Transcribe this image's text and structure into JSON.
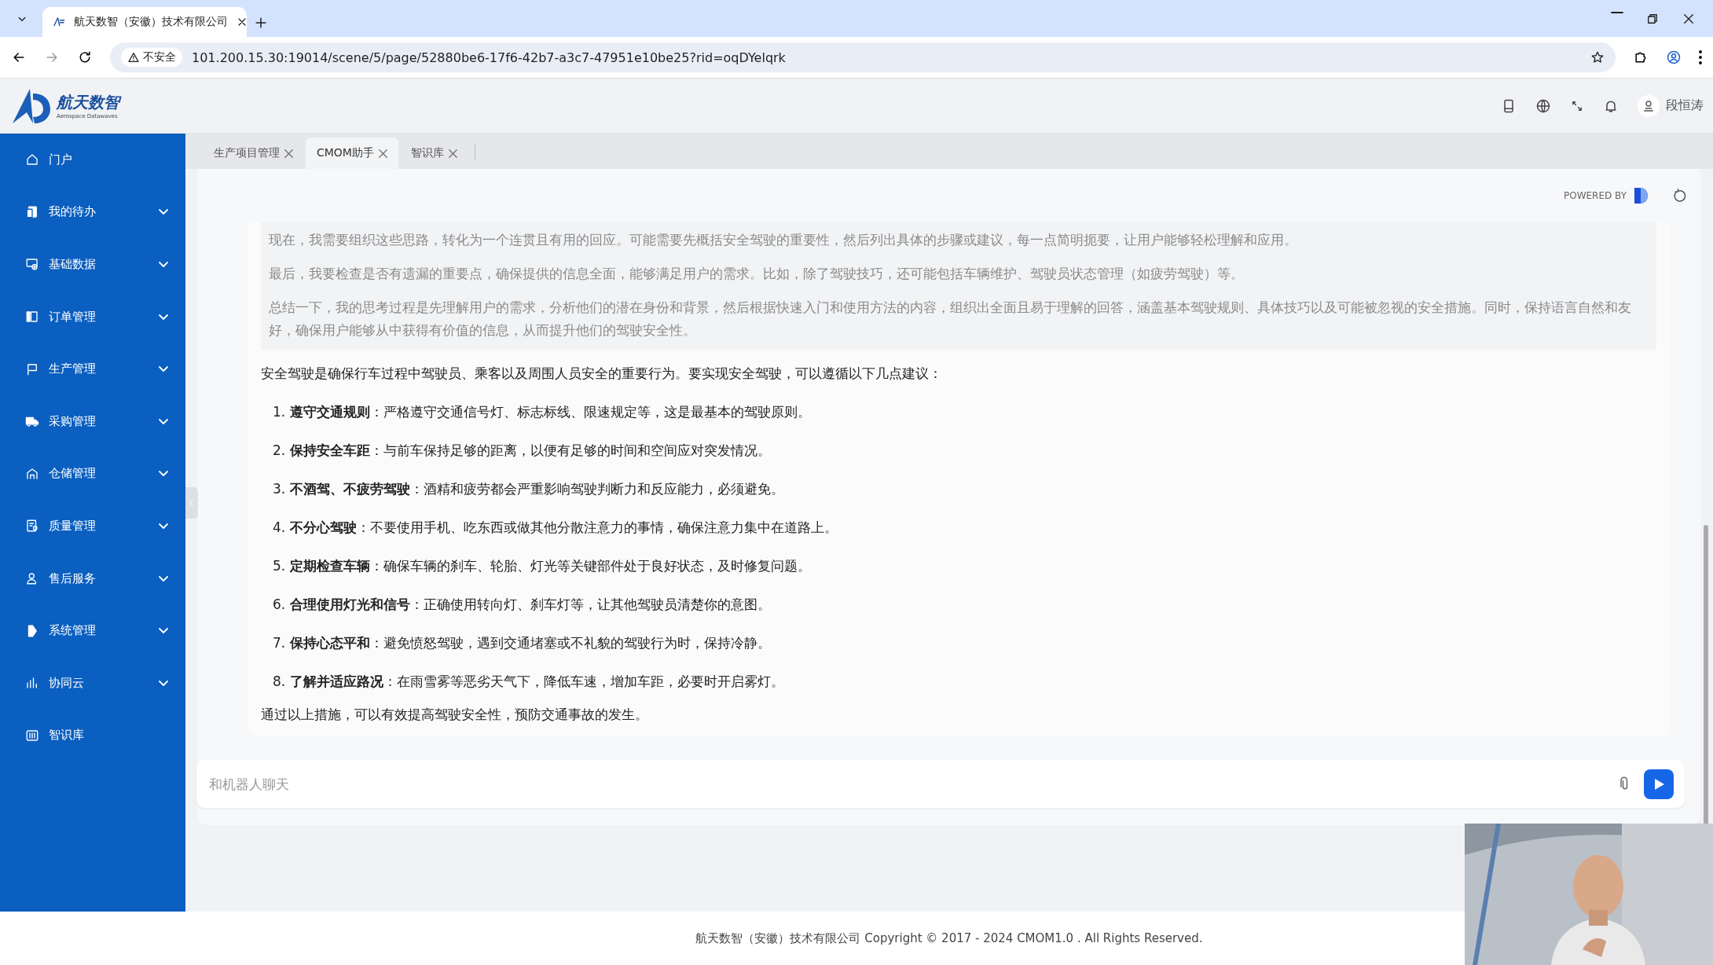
{
  "browser": {
    "tab_title": "航天数智（安徽）技术有限公司",
    "security": "不安全",
    "url": "101.200.15.30:19014/scene/5/page/52880be6-17f6-42b7-a3c7-47951e10be25?rid=oqDYelqrk"
  },
  "header": {
    "logo_name": "航天数智",
    "logo_subtitle": "Aerospace Datawaves",
    "user": "段恒涛"
  },
  "sidebar": {
    "items": [
      {
        "label": "门户",
        "kind": "link"
      },
      {
        "label": "我的待办",
        "kind": "group"
      },
      {
        "label": "基础数据",
        "kind": "group"
      },
      {
        "label": "订单管理",
        "kind": "group"
      },
      {
        "label": "生产管理",
        "kind": "group"
      },
      {
        "label": "采购管理",
        "kind": "group"
      },
      {
        "label": "仓储管理",
        "kind": "group"
      },
      {
        "label": "质量管理",
        "kind": "group"
      },
      {
        "label": "售后服务",
        "kind": "group"
      },
      {
        "label": "系统管理",
        "kind": "group"
      },
      {
        "label": "协同云",
        "kind": "group"
      },
      {
        "label": "智识库",
        "kind": "link"
      }
    ]
  },
  "tabs": [
    {
      "label": "生产项目管理",
      "selected": false
    },
    {
      "label": "CMOM助手",
      "selected": true
    },
    {
      "label": "智识库",
      "selected": false
    }
  ],
  "chat": {
    "powered_by": "POWERED BY",
    "thinking": [
      "现在，我需要组织这些思路，转化为一个连贯且有用的回应。可能需要先概括安全驾驶的重要性，然后列出具体的步骤或建议，每一点简明扼要，让用户能够轻松理解和应用。",
      "最后，我要检查是否有遗漏的重要点，确保提供的信息全面，能够满足用户的需求。比如，除了驾驶技巧，还可能包括车辆维护、驾驶员状态管理（如疲劳驾驶）等。",
      "总结一下，我的思考过程是先理解用户的需求，分析他们的潜在身份和背景，然后根据快速入门和使用方法的内容，组织出全面且易于理解的回答，涵盖基本驾驶规则、具体技巧以及可能被忽视的安全措施。同时，保持语言自然和友好，确保用户能够从中获得有价值的信息，从而提升他们的驾驶安全性。"
    ],
    "intro": "安全驾驶是确保行车过程中驾驶员、乘客以及周围人员安全的重要行为。要实现安全驾驶，可以遵循以下几点建议：",
    "points": [
      "1. **遵守交通规则**：严格遵守交通信号灯、标志标线、限速规定等，这是最基本的驾驶原则。",
      "2. **保持安全车距**：与前车保持足够的距离，以便有足够的时间和空间应对突发情况。",
      "3. **不酒驾、不疲劳驾驶**：酒精和疲劳都会严重影响驾驶判断力和反应能力，必须避免。",
      "4. **不分心驾驶**：不要使用手机、吃东西或做其他分散注意力的事情，确保注意力集中在道路上。",
      "5. **定期检查车辆**：确保车辆的刹车、轮胎、灯光等关键部件处于良好状态，及时修复问题。",
      "6. **合理使用灯光和信号**：正确使用转向灯、刹车灯等，让其他驾驶员清楚你的意图。",
      "7. **保持心态平和**：避免愤怒驾驶，遇到交通堵塞或不礼貌的驾驶行为时，保持冷静。",
      "8. **了解并适应路况**：在雨雪雾等恶劣天气下，降低车速，增加车距，必要时开启雾灯。"
    ],
    "outro": "通过以上措施，可以有效提高驾驶安全性，预防交通事故的发生。",
    "input_placeholder": "和机器人聊天"
  },
  "footer": "航天数智（安徽）技术有限公司 Copyright © 2017 - 2024 CMOM1.0 . All Rights Reserved."
}
